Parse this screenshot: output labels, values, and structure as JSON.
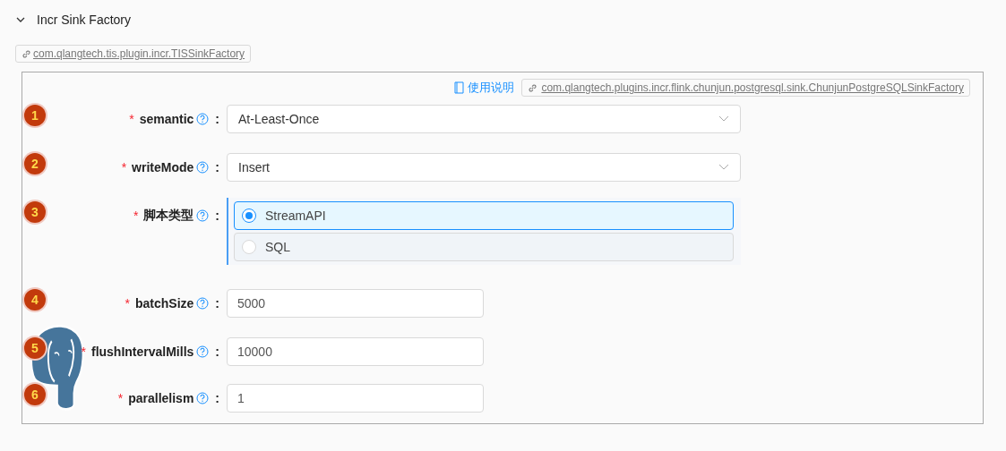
{
  "section": {
    "title": "Incr Sink Factory",
    "plugin": "com.qlangtech.tis.plugin.incr.TISSinkFactory"
  },
  "form": {
    "help_link": "使用说明",
    "impl": "com.qlangtech.plugins.incr.flink.chunjun.postgresql.sink.ChunjunPostgreSQLSinkFactory",
    "fields": [
      {
        "badge": "1",
        "mark": "*",
        "label": "semantic",
        "colon": ":",
        "kind": "select",
        "value": "At-Least-Once"
      },
      {
        "badge": "2",
        "mark": "*",
        "label": "writeMode",
        "colon": ":",
        "kind": "select",
        "value": "Insert"
      },
      {
        "badge": "3",
        "mark": "*",
        "label": "脚本类型",
        "colon": ":",
        "kind": "radio",
        "options": [
          {
            "label": "StreamAPI",
            "selected": true
          },
          {
            "label": "SQL",
            "selected": false
          }
        ]
      },
      {
        "badge": "4",
        "mark": "*",
        "label": "batchSize",
        "colon": ":",
        "kind": "input",
        "value": "5000"
      },
      {
        "badge": "5",
        "mark": "*",
        "label": "flushIntervalMills",
        "colon": ":",
        "kind": "input",
        "value": "10000"
      },
      {
        "badge": "6",
        "mark": "*",
        "label": "parallelism",
        "colon": ":",
        "kind": "input",
        "value": "1"
      }
    ]
  }
}
